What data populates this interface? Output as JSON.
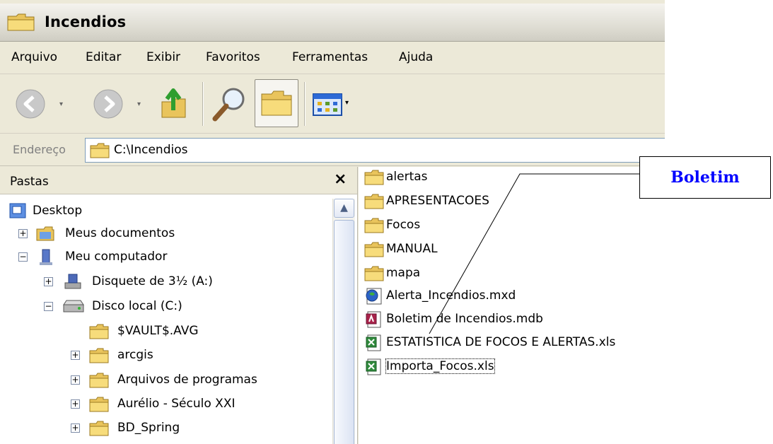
{
  "window": {
    "title": "Incendios"
  },
  "menu": [
    "Arquivo",
    "Editar",
    "Exibir",
    "Favoritos",
    "Ferramentas",
    "Ajuda"
  ],
  "toolbar": {
    "buttons": [
      "back-icon",
      "forward-icon",
      "up-folder-icon",
      "search-icon",
      "folders-icon",
      "views-icon"
    ]
  },
  "address": {
    "label": "Endereço",
    "path": "C:\\Incendios"
  },
  "folders_panel": {
    "title": "Pastas",
    "close": "×",
    "tree": [
      {
        "label": "Desktop",
        "expander": ""
      },
      {
        "label": "Meus documentos",
        "expander": "+"
      },
      {
        "label": "Meu computador",
        "expander": "−"
      },
      {
        "label": "Disquete de 3½ (A:)",
        "expander": "+"
      },
      {
        "label": "Disco local (C:)",
        "expander": "−"
      },
      {
        "label": "$VAULT$.AVG",
        "expander": ""
      },
      {
        "label": "arcgis",
        "expander": "+"
      },
      {
        "label": "Arquivos de programas",
        "expander": "+"
      },
      {
        "label": "Aurélio - Século XXI",
        "expander": "+"
      },
      {
        "label": "BD_Spring",
        "expander": "+"
      }
    ]
  },
  "files": [
    {
      "name": "alertas",
      "icon": "folder-icon"
    },
    {
      "name": "APRESENTACOES",
      "icon": "folder-icon"
    },
    {
      "name": "Focos",
      "icon": "folder-icon"
    },
    {
      "name": "MANUAL",
      "icon": "folder-icon"
    },
    {
      "name": "mapa",
      "icon": "folder-icon"
    },
    {
      "name": "Alerta_Incendios.mxd",
      "icon": "arcmap-icon"
    },
    {
      "name": "Boletim de Incendios.mdb",
      "icon": "access-db-icon"
    },
    {
      "name": "ESTATISTICA DE FOCOS E ALERTAS.xls",
      "icon": "excel-icon"
    },
    {
      "name": "Importa_Focos.xls",
      "icon": "excel-icon"
    }
  ],
  "callout": {
    "text": "Boletim"
  },
  "colors": {
    "callout_text": "#0000ff",
    "folder": "#f2cf55",
    "window_bg": "#ece9d8"
  }
}
